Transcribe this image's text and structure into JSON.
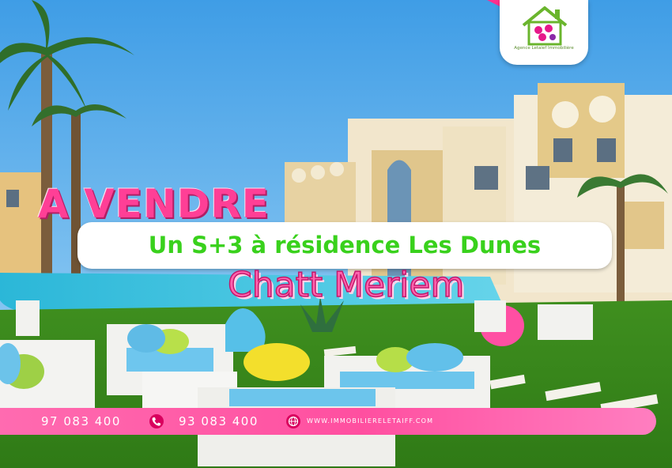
{
  "headline": "A VENDRE",
  "property": "Un S+3 à résidence Les Dunes",
  "location": "Chatt Meriem",
  "contact": {
    "phone_1": "97 083 400",
    "phone_2": "93 083 400",
    "website": "WWW.IMMOBILIERELETAIFF.COM"
  },
  "logo": {
    "tagline": "Agence Letaief Immobilière"
  },
  "icons": {
    "phone": "phone-icon",
    "web": "globe-icon",
    "logo": "house-logo-icon"
  },
  "colors": {
    "accent_pink": "#ff3f96",
    "accent_green": "#39d11c",
    "banner_pink": "#ff5aa5"
  }
}
